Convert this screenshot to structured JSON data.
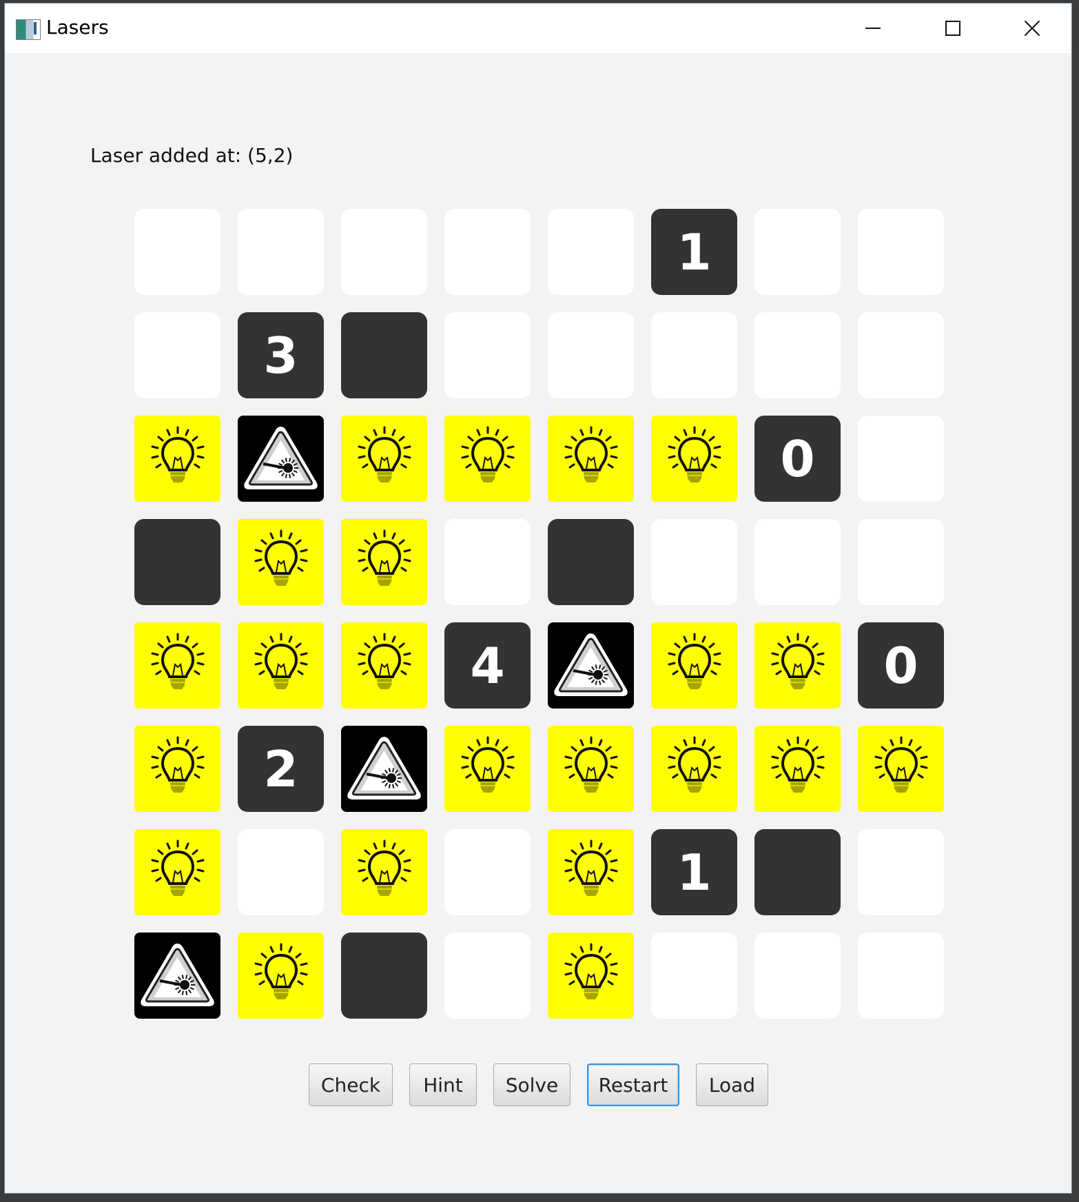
{
  "window": {
    "title": "Lasers",
    "app_icon": "lasers-app-icon",
    "controls": [
      "minimize-icon",
      "maximize-icon",
      "close-icon"
    ]
  },
  "status_message": "Laser added at: (5,2)",
  "board": {
    "rows": 8,
    "cols": 8,
    "cells": [
      [
        ".",
        ".",
        ".",
        ".",
        ".",
        "1",
        ".",
        "."
      ],
      [
        ".",
        "3",
        "X",
        ".",
        ".",
        ".",
        ".",
        "."
      ],
      [
        "*",
        "L",
        "*",
        "*",
        "*",
        "*",
        "0",
        "."
      ],
      [
        "X",
        "*",
        "*",
        ".",
        "X",
        ".",
        ".",
        "."
      ],
      [
        "*",
        "*",
        "*",
        "4",
        "L",
        "*",
        "*",
        "0"
      ],
      [
        "*",
        "2",
        "L",
        "*",
        "*",
        "*",
        "*",
        "*"
      ],
      [
        "*",
        ".",
        "*",
        ".",
        "*",
        "1",
        "X",
        "."
      ],
      [
        "L",
        "*",
        "X",
        ".",
        "*",
        ".",
        ".",
        "."
      ]
    ],
    "legend_icons": {
      ".": "empty-cell",
      "X": "blank-pillar",
      "*": "lightbulb-beam-icon",
      "L": "laser-warning-icon"
    },
    "colors": {
      "empty": "#ffffff",
      "pillar": "#333333",
      "beam": "#ffff00",
      "laser": "#000000"
    }
  },
  "buttons": [
    {
      "id": "check",
      "label": "Check"
    },
    {
      "id": "hint",
      "label": "Hint"
    },
    {
      "id": "solve",
      "label": "Solve"
    },
    {
      "id": "restart",
      "label": "Restart",
      "focused": true
    },
    {
      "id": "load",
      "label": "Load"
    }
  ]
}
